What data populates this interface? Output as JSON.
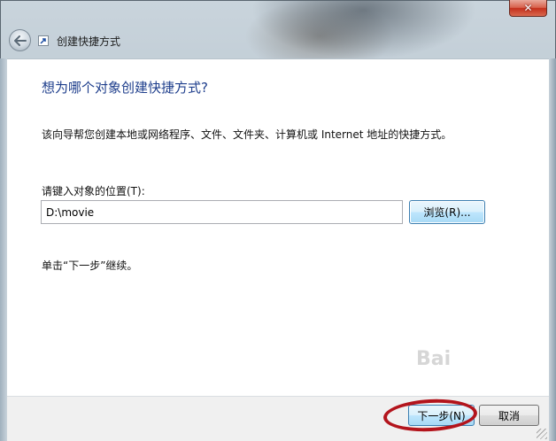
{
  "window": {
    "title": "创建快捷方式",
    "close_glyph": "✕"
  },
  "wizard": {
    "heading": "想为哪个对象创建快捷方式?",
    "description": "该向导帮您创建本地或网络程序、文件、文件夹、计算机或 Internet 地址的快捷方式。",
    "location_label": "请键入对象的位置(T):",
    "location_value": "D:\\movie",
    "browse_label": "浏览(R)...",
    "hint": "单击“下一步”继续。"
  },
  "footer": {
    "next_label": "下一步(N)",
    "cancel_label": "取消"
  },
  "watermark": "Bai",
  "colors": {
    "heading": "#1e3e8c",
    "highlight_ring": "#b3141c",
    "close_button": "#c4301c"
  },
  "icons": {
    "back": "back-arrow-icon",
    "shortcut": "shortcut-icon",
    "close": "close-icon"
  }
}
